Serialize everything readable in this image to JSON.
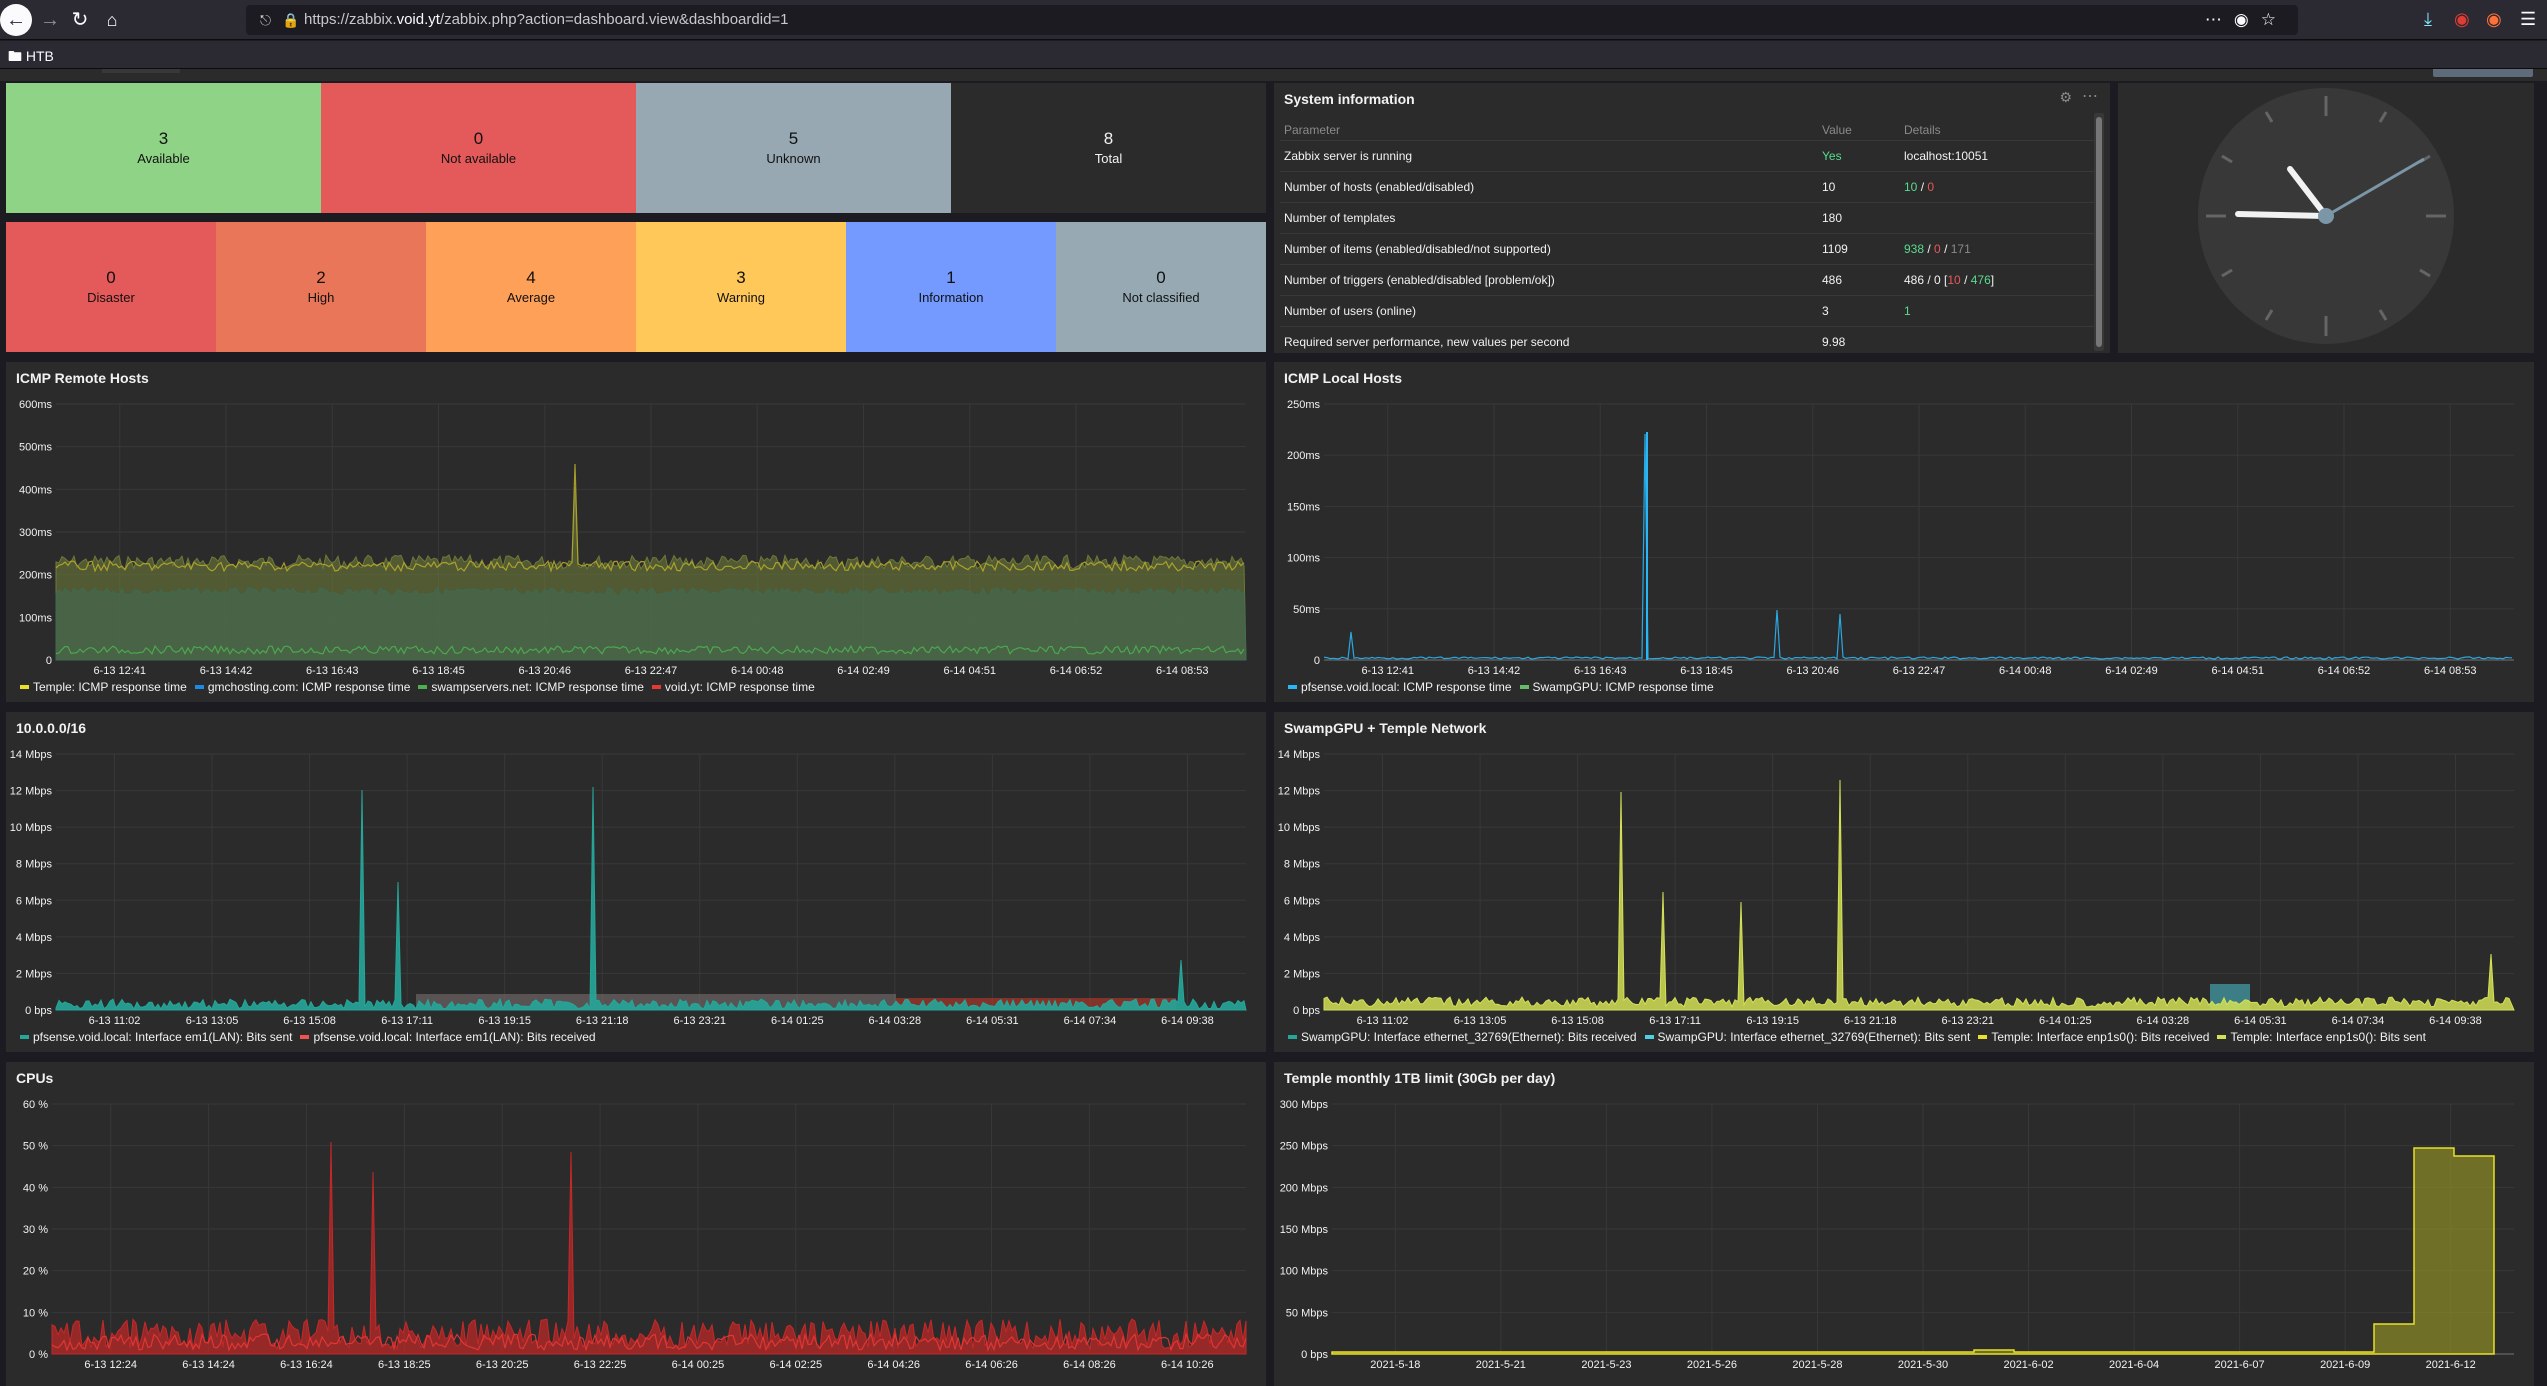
{
  "browser": {
    "url_prefix": "https://zabbix.",
    "url_domain": "void.yt",
    "url_suffix": "/zabbix.php?action=dashboard.view&dashboardid=1",
    "bookmark_folder": "HTB"
  },
  "host_availability": [
    {
      "count": "3",
      "label": "Available",
      "color": "#8fd386"
    },
    {
      "count": "0",
      "label": "Not available",
      "color": "#e45959"
    },
    {
      "count": "5",
      "label": "Unknown",
      "color": "#97a8b3"
    },
    {
      "count": "8",
      "label": "Total",
      "color": "#2b2b2b"
    }
  ],
  "problems_by_severity": [
    {
      "count": "0",
      "label": "Disaster",
      "color": "#e45959"
    },
    {
      "count": "2",
      "label": "High",
      "color": "#e97659"
    },
    {
      "count": "4",
      "label": "Average",
      "color": "#ffa059"
    },
    {
      "count": "3",
      "label": "Warning",
      "color": "#ffc859"
    },
    {
      "count": "1",
      "label": "Information",
      "color": "#7499ff"
    },
    {
      "count": "0",
      "label": "Not classified",
      "color": "#97aab3"
    }
  ],
  "system_info": {
    "title": "System information",
    "headers": {
      "parameter": "Parameter",
      "value": "Value",
      "details": "Details"
    },
    "rows": [
      {
        "param": "Zabbix server is running",
        "value": "Yes",
        "details": "localhost:10051"
      },
      {
        "param": "Number of hosts (enabled/disabled)",
        "value": "10",
        "d1": "10",
        "d2": "0"
      },
      {
        "param": "Number of templates",
        "value": "180"
      },
      {
        "param": "Number of items (enabled/disabled/not supported)",
        "value": "1109",
        "d1": "938",
        "d2": "0",
        "d3": "171"
      },
      {
        "param": "Number of triggers (enabled/disabled [problem/ok])",
        "value": "486",
        "d0": "486 / 0 [",
        "d1": "10",
        "d2": "476",
        "d3": "]"
      },
      {
        "param": "Number of users (online)",
        "value": "3",
        "d1": "1"
      },
      {
        "param": "Required server performance, new values per second",
        "value": "9.98"
      }
    ]
  },
  "graphs": {
    "icmp_remote": {
      "title": "ICMP Remote Hosts",
      "y_ticks": [
        "600ms",
        "500ms",
        "400ms",
        "300ms",
        "200ms",
        "100ms",
        "0"
      ],
      "x_ticks": [
        "6-13 12:41",
        "6-13 14:42",
        "6-13 16:43",
        "6-13 18:45",
        "6-13 20:46",
        "6-13 22:47",
        "6-14 00:48",
        "6-14 02:49",
        "6-14 04:51",
        "6-14 06:52",
        "6-14 08:53"
      ],
      "legend": [
        {
          "name": "Temple: ICMP response time",
          "color": "#e8e02a"
        },
        {
          "name": "gmchosting.com: ICMP response time",
          "color": "#1e88e5"
        },
        {
          "name": "swampservers.net: ICMP response time",
          "color": "#4caf50"
        },
        {
          "name": "void.yt: ICMP response time",
          "color": "#e53935"
        }
      ]
    },
    "icmp_local": {
      "title": "ICMP Local Hosts",
      "y_ticks": [
        "250ms",
        "200ms",
        "150ms",
        "100ms",
        "50ms",
        "0"
      ],
      "x_ticks": [
        "6-13 12:41",
        "6-13 14:42",
        "6-13 16:43",
        "6-13 18:45",
        "6-13 20:46",
        "6-13 22:47",
        "6-14 00:48",
        "6-14 02:49",
        "6-14 04:51",
        "6-14 06:52",
        "6-14 08:53"
      ],
      "legend": [
        {
          "name": "pfsense.void.local: ICMP response time",
          "color": "#29b6f6"
        },
        {
          "name": "SwampGPU: ICMP response time",
          "color": "#66bb6a"
        }
      ]
    },
    "net_10": {
      "title": "10.0.0.0/16",
      "y_ticks": [
        "14 Mbps",
        "12 Mbps",
        "10 Mbps",
        "8 Mbps",
        "6 Mbps",
        "4 Mbps",
        "2 Mbps",
        "0 bps"
      ],
      "x_ticks": [
        "6-13 11:02",
        "6-13 13:05",
        "6-13 15:08",
        "6-13 17:11",
        "6-13 19:15",
        "6-13 21:18",
        "6-13 23:21",
        "6-14 01:25",
        "6-14 03:28",
        "6-14 05:31",
        "6-14 07:34",
        "6-14 09:38"
      ],
      "legend": [
        {
          "name": "pfsense.void.local: Interface em1(LAN): Bits sent",
          "color": "#26a69a"
        },
        {
          "name": "pfsense.void.local: Interface em1(LAN): Bits received",
          "color": "#ef5350"
        }
      ]
    },
    "swamp_temple": {
      "title": "SwampGPU + Temple Network",
      "y_ticks": [
        "14 Mbps",
        "12 Mbps",
        "10 Mbps",
        "8 Mbps",
        "6 Mbps",
        "4 Mbps",
        "2 Mbps",
        "0 bps"
      ],
      "x_ticks": [
        "6-13 11:02",
        "6-13 13:05",
        "6-13 15:08",
        "6-13 17:11",
        "6-13 19:15",
        "6-13 21:18",
        "6-13 23:21",
        "6-14 01:25",
        "6-14 03:28",
        "6-14 05:31",
        "6-14 07:34",
        "6-14 09:38"
      ],
      "legend": [
        {
          "name": "SwampGPU: Interface ethernet_32769(Ethernet): Bits received",
          "color": "#26a69a"
        },
        {
          "name": "SwampGPU: Interface ethernet_32769(Ethernet): Bits sent",
          "color": "#4dd0e1"
        },
        {
          "name": "Temple: Interface enp1s0(): Bits received",
          "color": "#e8e02a"
        },
        {
          "name": "Temple: Interface enp1s0(): Bits sent",
          "color": "#d4e157"
        }
      ]
    },
    "cpus": {
      "title": "CPUs",
      "y_ticks": [
        "60 %",
        "50 %",
        "40 %",
        "30 %",
        "20 %",
        "10 %",
        "0 %"
      ],
      "x_ticks": [
        "6-13 12:24",
        "6-13 14:24",
        "6-13 16:24",
        "6-13 18:25",
        "6-13 20:25",
        "6-13 22:25",
        "6-14 00:25",
        "6-14 02:25",
        "6-14 04:26",
        "6-14 06:26",
        "6-14 08:26",
        "6-14 10:26"
      ]
    },
    "temple_monthly": {
      "title": "Temple monthly 1TB limit (30Gb per day)",
      "y_ticks": [
        "300 Mbps",
        "250 Mbps",
        "200 Mbps",
        "150 Mbps",
        "100 Mbps",
        "50 Mbps",
        "0 bps"
      ],
      "x_ticks": [
        "2021-5-18",
        "2021-5-21",
        "2021-5-23",
        "2021-5-26",
        "2021-5-28",
        "2021-5-30",
        "2021-6-02",
        "2021-6-04",
        "2021-6-07",
        "2021-6-09",
        "2021-6-12"
      ]
    }
  }
}
